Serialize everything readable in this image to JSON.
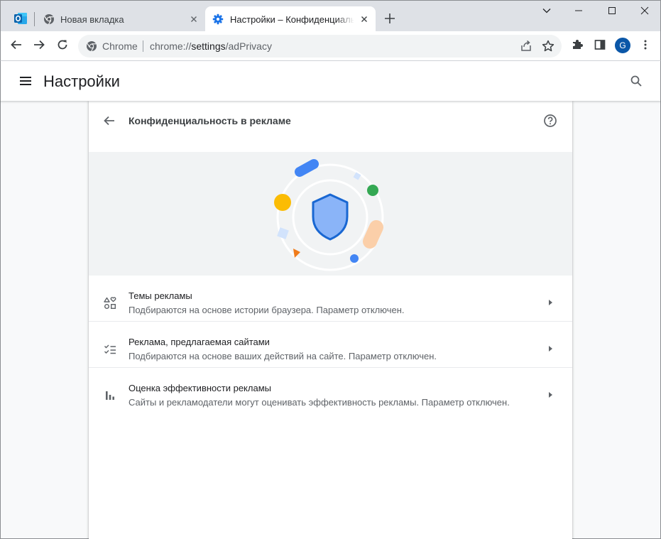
{
  "colors": {
    "tabstrip_bg": "#dee1e6",
    "accent_blue": "#1a73e8",
    "avatar_bg": "#0b57a8",
    "banner_bg": "#f1f3f4",
    "page_bg": "#f8f9fa"
  },
  "tabs": [
    {
      "title": "Новая вкладка",
      "icon": "chrome-icon",
      "active": false
    },
    {
      "title": "Настройки – Конфиденциальность в рекламе",
      "icon": "settings-gear-icon",
      "active": true
    }
  ],
  "window_controls": [
    "chevron-down-icon",
    "minimize-icon",
    "maximize-icon",
    "close-icon"
  ],
  "toolbar": {
    "chip": "Chrome",
    "url_scheme": "chrome://",
    "url_host": "settings",
    "url_path": "/adPrivacy",
    "avatar_letter": "G"
  },
  "settings_header": {
    "title": "Настройки"
  },
  "card": {
    "title": "Конфиденциальность в рекламе",
    "rows": [
      {
        "icon": "ad-topics-icon",
        "title": "Темы рекламы",
        "subtitle": "Подбираются на основе истории браузера. Параметр отключен."
      },
      {
        "icon": "site-suggested-ads-icon",
        "title": "Реклама, предлагаемая сайтами",
        "subtitle": "Подбираются на основе ваших действий на сайте. Параметр отключен."
      },
      {
        "icon": "ad-measurement-icon",
        "title": "Оценка эффективности рекламы",
        "subtitle": "Сайты и рекламодатели могут оценивать эффективность рекламы. Параметр отключен."
      }
    ]
  }
}
